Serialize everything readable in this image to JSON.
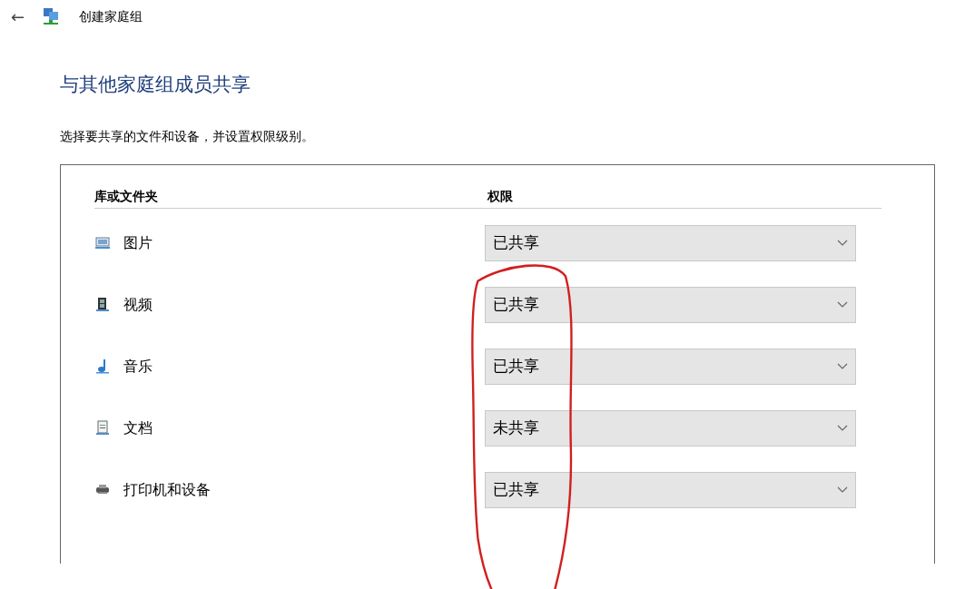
{
  "back_button": "←",
  "window": {
    "title": "创建家庭组"
  },
  "heading": "与其他家庭组成员共享",
  "description": "选择要共享的文件和设备，并设置权限级别。",
  "table": {
    "columns": [
      "库或文件夹",
      "权限"
    ],
    "rows": [
      {
        "kind": "pictures",
        "name": "图片",
        "permission": "已共享"
      },
      {
        "kind": "videos",
        "name": "视频",
        "permission": "已共享"
      },
      {
        "kind": "music",
        "name": "音乐",
        "permission": "已共享"
      },
      {
        "kind": "documents",
        "name": "文档",
        "permission": "未共享"
      },
      {
        "kind": "printers",
        "name": "打印机和设备",
        "permission": "已共享"
      }
    ]
  }
}
